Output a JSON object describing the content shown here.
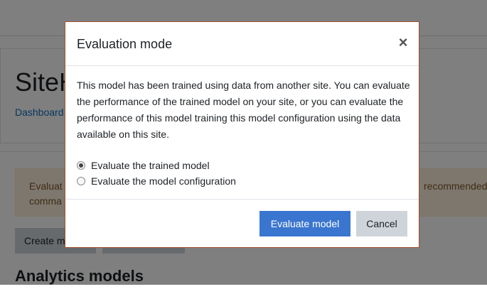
{
  "background": {
    "site_title": "SiteH",
    "breadcrumb": "Dashboard",
    "alert_left_line1": "Evaluat",
    "alert_left_line2": "comma",
    "alert_right": "recommended t",
    "create_button": "Create m",
    "section_title": "Analytics models"
  },
  "modal": {
    "title": "Evaluation mode",
    "close_symbol": "×",
    "description": "This model has been trained using data from another site. You can evaluate the performance of the trained model on your site, or you can evaluate the performance of this model training this model configuration using the data available on this site.",
    "options": [
      {
        "label": "Evaluate the trained model",
        "checked": true
      },
      {
        "label": "Evaluate the model configuration",
        "checked": false
      }
    ],
    "primary_button": "Evaluate model",
    "cancel_button": "Cancel"
  },
  "colors": {
    "primary": "#3a76cf",
    "secondary": "#ced4da",
    "modal_border": "#a0522d",
    "alert_bg": "#fcefdc"
  }
}
